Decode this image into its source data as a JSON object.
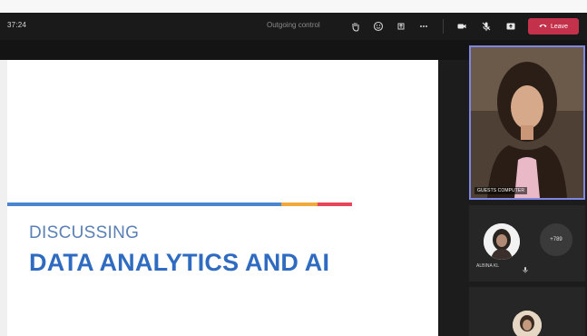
{
  "meeting_bar": {
    "time": "37:24",
    "status": "Outgoing control",
    "icons": [
      "raise-hand-icon",
      "reactions-icon",
      "share-icon",
      "more-icon",
      "camera-icon",
      "mic-icon",
      "share-tray-icon"
    ],
    "leave_label": "Leave",
    "leave_color": "#c4314b"
  },
  "slide": {
    "kicker": "DISCUSSING",
    "title": "DATA ANALYTICS AND AI",
    "rule_colors": [
      "#4a86cf",
      "#f2a93b",
      "#e8455b"
    ]
  },
  "video": {
    "name": "GUESTS COMPUTER",
    "border_color": "#7f86e0"
  },
  "participants": {
    "name": "ALBINA KL",
    "more_count": "+789"
  }
}
